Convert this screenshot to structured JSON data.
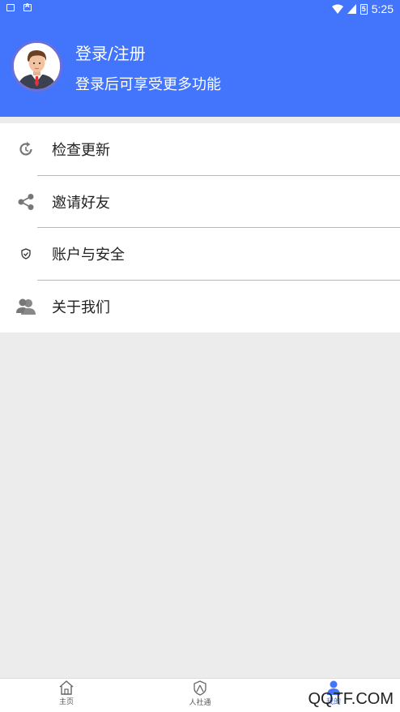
{
  "status_bar": {
    "time": "5:25",
    "battery": "5"
  },
  "header": {
    "title": "登录/注册",
    "subtitle": "登录后可享受更多功能",
    "bg_color": "#4275fb"
  },
  "menu": {
    "items": [
      {
        "label": "检查更新",
        "icon": "refresh-icon"
      },
      {
        "label": "邀请好友",
        "icon": "share-icon"
      },
      {
        "label": "账户与安全",
        "icon": "shield-icon"
      },
      {
        "label": "关于我们",
        "icon": "users-icon"
      }
    ]
  },
  "tabbar": {
    "tabs": [
      {
        "label": "主页",
        "icon": "home-icon"
      },
      {
        "label": "人社通",
        "icon": "person-shield-icon"
      },
      {
        "label": "我的",
        "icon": "person-icon",
        "active": true
      }
    ]
  },
  "watermark": "QQTF.COM"
}
